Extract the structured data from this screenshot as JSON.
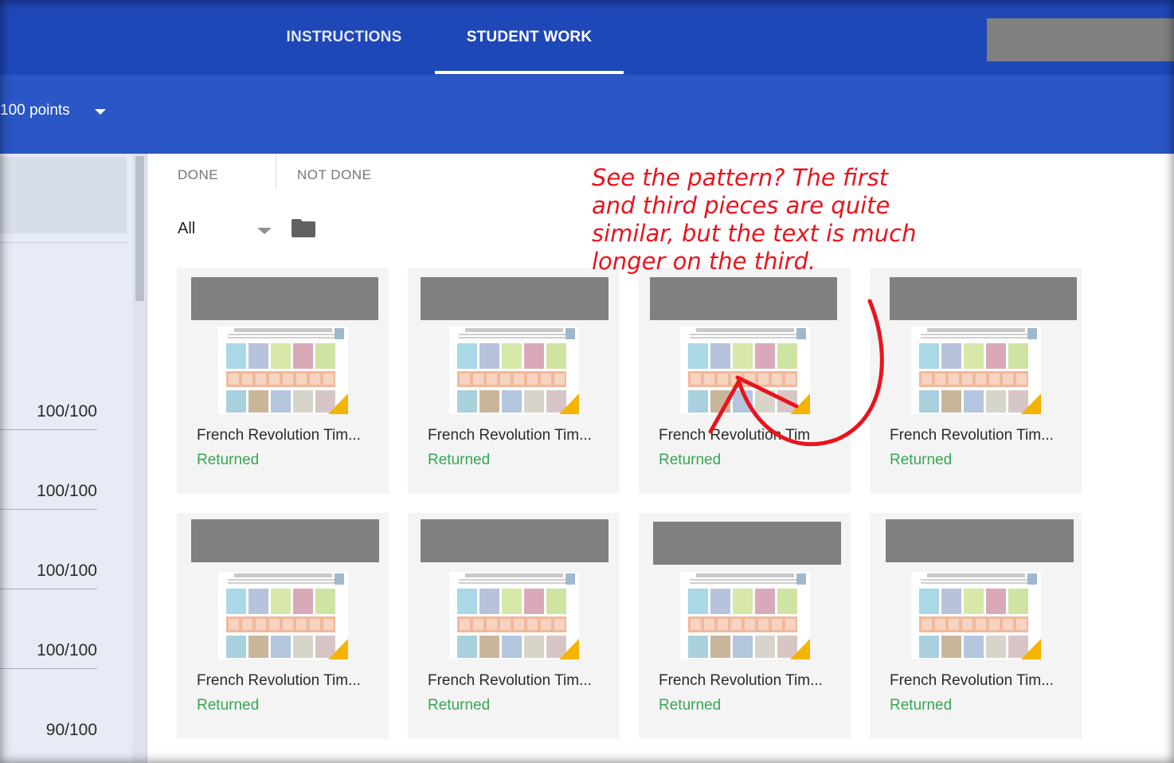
{
  "header": {
    "tabs": [
      {
        "label": "INSTRUCTIONS",
        "active": false
      },
      {
        "label": "STUDENT WORK",
        "active": true
      }
    ]
  },
  "subheader": {
    "points_label": "100 points"
  },
  "grades": [
    "100/100",
    "100/100",
    "100/100",
    "100/100",
    "90/100"
  ],
  "filters": {
    "tabs": [
      "DONE",
      "NOT DONE"
    ],
    "dropdown_value": "All"
  },
  "cards": [
    {
      "title": "French Revolution Tim...",
      "status": "Returned"
    },
    {
      "title": "French Revolution Tim...",
      "status": "Returned"
    },
    {
      "title": "French Revolution Tim",
      "status": "Returned"
    },
    {
      "title": "French Revolution Tim...",
      "status": "Returned"
    },
    {
      "title": "French Revolution Tim...",
      "status": "Returned"
    },
    {
      "title": "French Revolution Tim...",
      "status": "Returned"
    },
    {
      "title": "French Revolution Tim...",
      "status": "Returned"
    },
    {
      "title": "French Revolution Tim...",
      "status": "Returned"
    }
  ],
  "annotation": {
    "lines": [
      "See the pattern? The first",
      "and third pieces are quite",
      "similar, but the text is much",
      "longer on the third."
    ],
    "color": "#e8141d"
  },
  "colors": {
    "header": "#1e47b8",
    "subheader": "#2a56c6",
    "returned": "#34a853"
  }
}
